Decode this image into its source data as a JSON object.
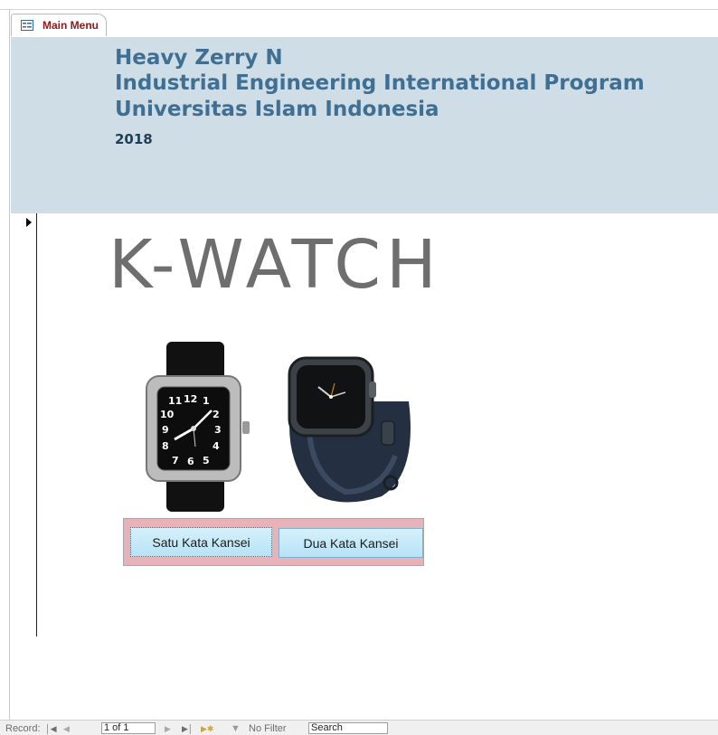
{
  "tab": {
    "label": "Main Menu",
    "icon": "form-icon"
  },
  "header": {
    "line1": "Heavy Zerry N",
    "line2": "Industrial Engineering International Program",
    "line3": "Universitas Islam Indonesia",
    "year": "2018",
    "background": "#cfdde7",
    "text_color": "#3f6f93"
  },
  "brand": {
    "title": "K-WATCH"
  },
  "buttons": {
    "first": "Satu Kata Kansei",
    "second": "Dua Kata Kansei",
    "panel_color": "#e5b3b8"
  },
  "images": {
    "watch1": "analog-watch-image",
    "watch2": "smart-watch-image"
  },
  "statusbar": {
    "record_label": "Record:",
    "first_icon": "first-record-icon",
    "prev_icon": "prev-record-icon",
    "position": "1 of 1",
    "next_icon": "next-record-icon",
    "last_icon": "last-record-icon",
    "new_icon": "new-record-icon",
    "filter_label": "No Filter",
    "search_placeholder": "Search"
  }
}
